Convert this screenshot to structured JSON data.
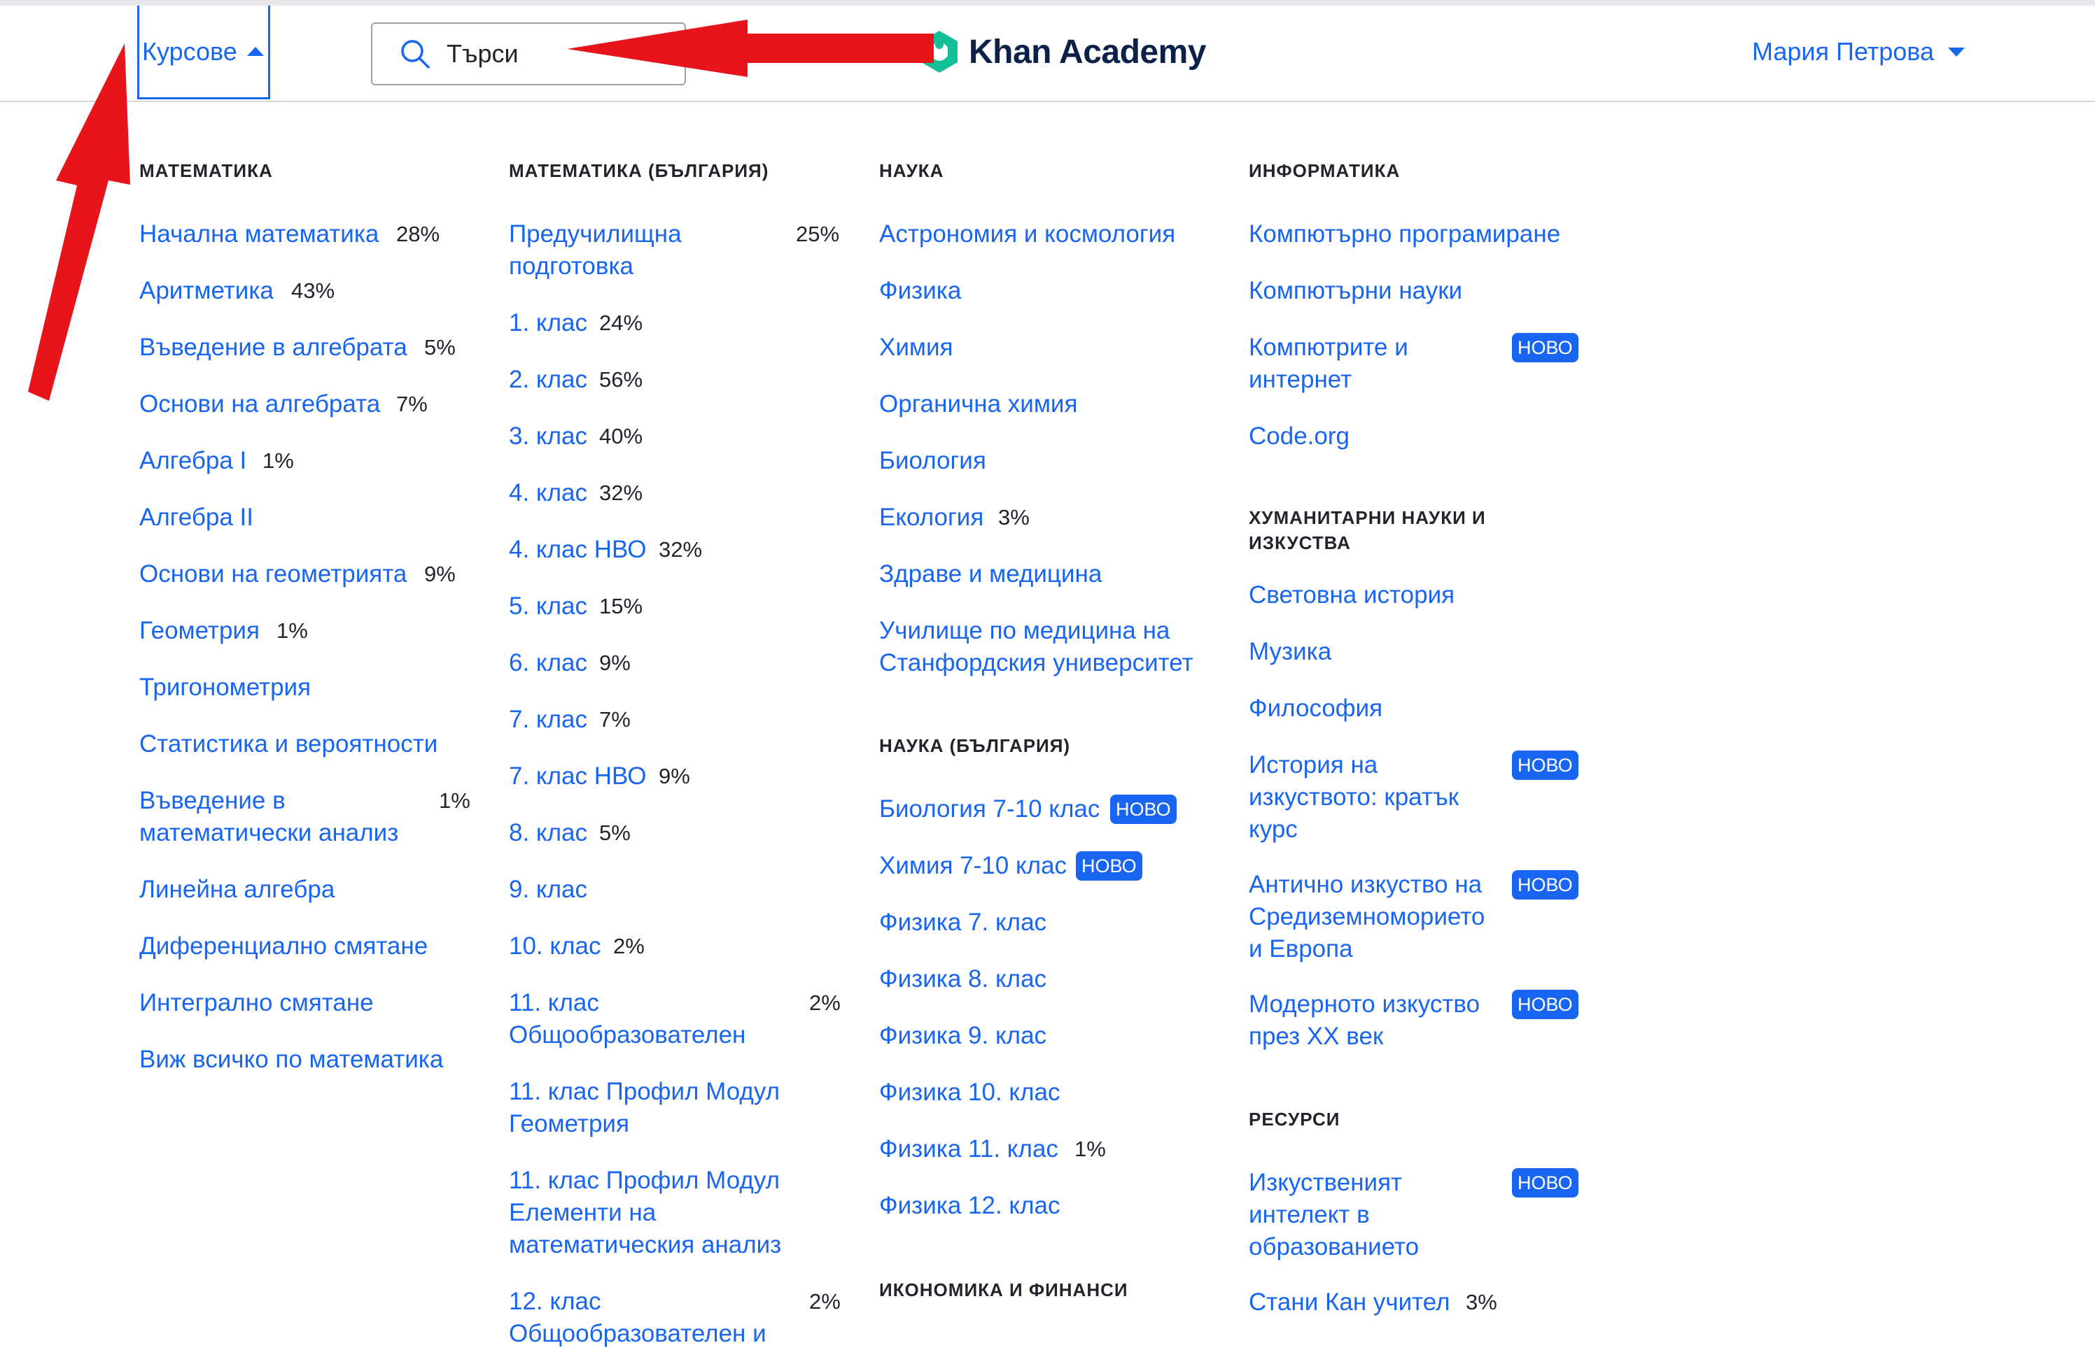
{
  "header": {
    "courses_label": "Курсове",
    "search_placeholder": "Търси",
    "logo_text": "Khan Academy",
    "user_name": "Мария Петрова"
  },
  "menu": {
    "col1": {
      "title": "МАТЕМАТИКА",
      "items": [
        {
          "label": "Начална математика",
          "pct": "28%"
        },
        {
          "label": "Аритметика",
          "pct": "43%"
        },
        {
          "label": "Въведение в алгебрата",
          "pct": "5%"
        },
        {
          "label": "Основи на алгебрата",
          "pct": "7%"
        },
        {
          "label": "Алгебра I",
          "pct": "1%"
        },
        {
          "label": "Алгебра II",
          "pct": ""
        },
        {
          "label": "Основи на геометрията",
          "pct": "9%"
        },
        {
          "label": "Геометрия",
          "pct": "1%"
        },
        {
          "label": "Тригонометрия",
          "pct": ""
        },
        {
          "label": "Статистика и вероятности",
          "pct": ""
        },
        {
          "label": "Въведение в математически анализ",
          "pct": "1%"
        },
        {
          "label": "Линейна алгебра",
          "pct": ""
        },
        {
          "label": "Диференциално смятане",
          "pct": ""
        },
        {
          "label": "Интегрално смятане",
          "pct": ""
        },
        {
          "label": "Виж всичко по математика",
          "pct": ""
        }
      ]
    },
    "col2": {
      "title": "МАТЕМАТИКА (БЪЛГАРИЯ)",
      "items": [
        {
          "label": "Предучилищна подготовка",
          "pct": "25%"
        },
        {
          "label": "1. клас",
          "pct": "24%"
        },
        {
          "label": "2. клас",
          "pct": "56%"
        },
        {
          "label": "3. клас",
          "pct": "40%"
        },
        {
          "label": "4. клас",
          "pct": "32%"
        },
        {
          "label": "4. клас НВО",
          "pct": "32%"
        },
        {
          "label": "5. клас",
          "pct": "15%"
        },
        {
          "label": "6. клас",
          "pct": "9%"
        },
        {
          "label": "7. клас",
          "pct": "7%"
        },
        {
          "label": "7. клас НВО",
          "pct": "9%"
        },
        {
          "label": "8. клас",
          "pct": "5%"
        },
        {
          "label": "9. клас",
          "pct": ""
        },
        {
          "label": "10. клас",
          "pct": "2%"
        },
        {
          "label": "11. клас Общообразователен",
          "pct": "2%"
        },
        {
          "label": "11. клас Профил Модул Геометрия",
          "pct": ""
        },
        {
          "label": "11. клас Профил Модул Елементи на математическия анализ",
          "pct": ""
        },
        {
          "label": "12. клас Общообразователен и",
          "pct": "2%"
        }
      ]
    },
    "col3": {
      "title": "НАУКА",
      "items": [
        {
          "label": "Астрономия и космология"
        },
        {
          "label": "Физика"
        },
        {
          "label": "Химия"
        },
        {
          "label": "Органична химия"
        },
        {
          "label": "Биология"
        },
        {
          "label": "Екология",
          "pct": "3%"
        },
        {
          "label": "Здраве и медицина"
        },
        {
          "label": "Училище по медицина на Станфордския университет"
        }
      ],
      "title2": "НАУКА (БЪЛГАРИЯ)",
      "items2": [
        {
          "label": "Биология 7-10 клас",
          "badge": "НОВО"
        },
        {
          "label": "Химия 7-10 клас",
          "badge": "НОВО"
        },
        {
          "label": "Физика 7. клас"
        },
        {
          "label": "Физика 8. клас"
        },
        {
          "label": "Физика 9. клас"
        },
        {
          "label": "Физика 10. клас"
        },
        {
          "label": "Физика 11. клас",
          "pct": "1%"
        },
        {
          "label": "Физика 12. клас"
        }
      ],
      "title3": "ИКОНОМИКА И ФИНАНСИ"
    },
    "col4": {
      "title": "ИНФОРМАТИКА",
      "items": [
        {
          "label": "Компютърно програмиране"
        },
        {
          "label": "Компютърни науки"
        },
        {
          "label": "Компютрите и интернет",
          "badge": "НОВО"
        },
        {
          "label": "Code.org"
        }
      ],
      "title2": "ХУМАНИТАРНИ НАУКИ И ИЗКУСТВА",
      "items2": [
        {
          "label": "Световна история"
        },
        {
          "label": "Музика"
        },
        {
          "label": "Философия"
        },
        {
          "label": "История на изкуството: кратък курс",
          "badge": "НОВО"
        },
        {
          "label": "Антично изкуство на Средиземноморието и Европа",
          "badge": "НОВО"
        },
        {
          "label": "Модерното изкуство през ХХ век",
          "badge": "НОВО"
        }
      ],
      "title3": "РЕСУРСИ",
      "items3": [
        {
          "label": "Изкуственият интелект в образованието",
          "badge": "НОВО"
        },
        {
          "label": "Стани Кан учител",
          "pct": "3%"
        }
      ]
    }
  },
  "colors": {
    "accent": "#1865f2",
    "arrow": "#e8141c",
    "text": "#21242c",
    "logo_green": "#14bf96"
  }
}
